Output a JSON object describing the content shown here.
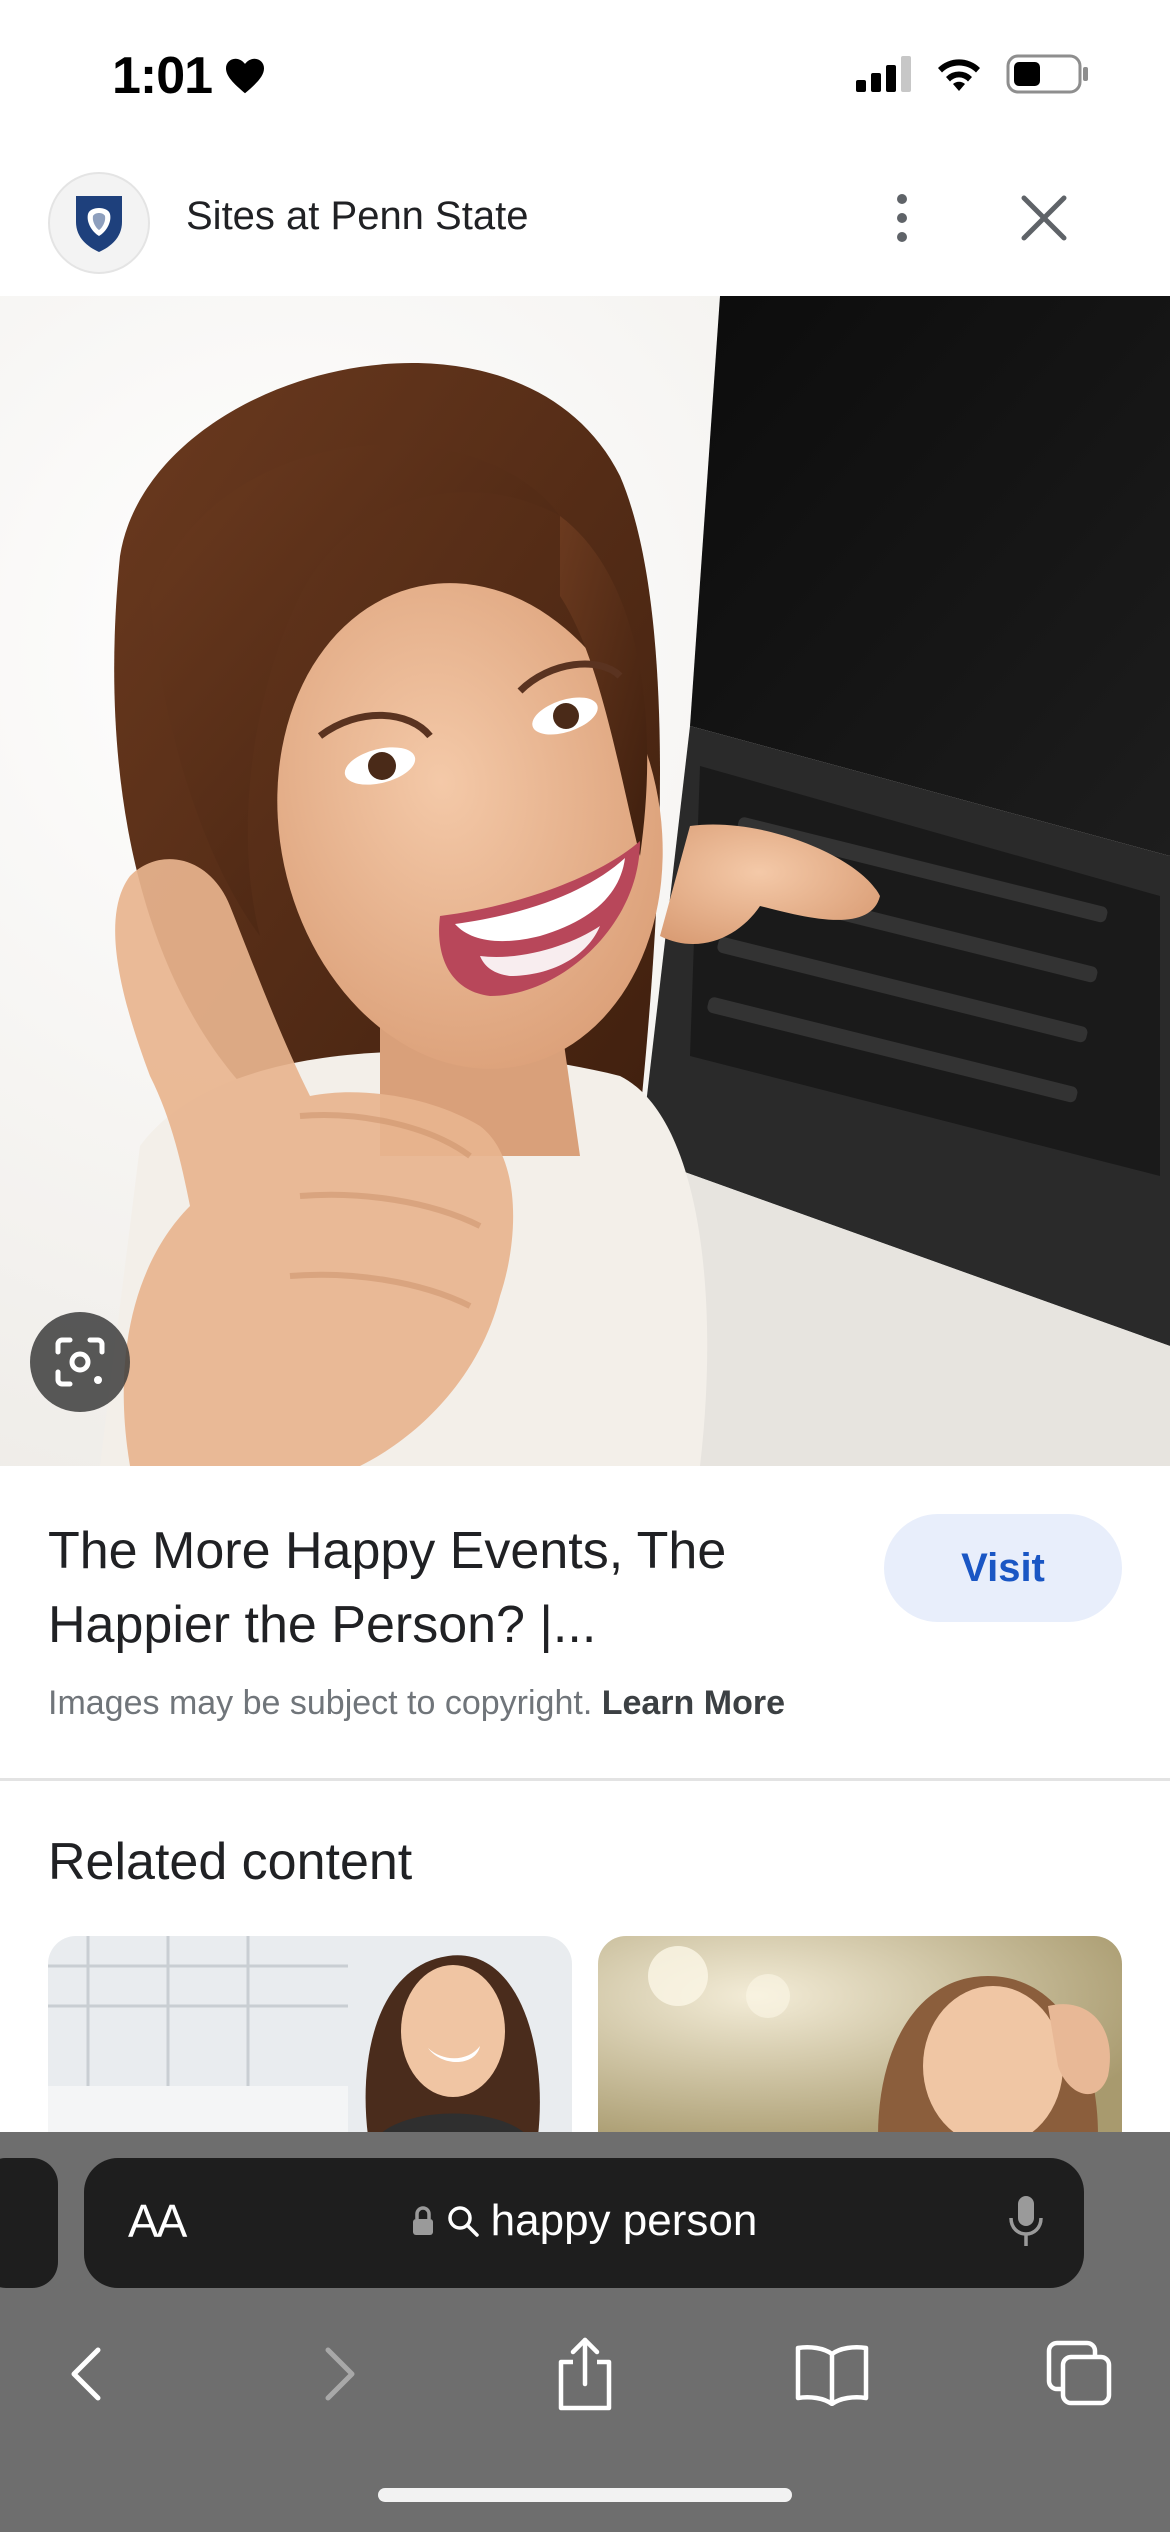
{
  "status_bar": {
    "time": "1:01"
  },
  "header": {
    "site_name": "Sites at Penn State"
  },
  "result": {
    "title": "The More Happy Events, The Happier the Person? |...",
    "visit_label": "Visit",
    "copyright_text": "Images may be subject to copyright.",
    "learn_more_label": "Learn More"
  },
  "related": {
    "heading": "Related content"
  },
  "browser": {
    "text_size_label": "AA",
    "search_query": "happy person"
  },
  "icons": {
    "status": [
      "heart-icon",
      "cellular-signal-icon",
      "wifi-icon",
      "battery-icon"
    ],
    "header": [
      "penn-state-shield-icon",
      "more-vertical-icon",
      "close-icon"
    ],
    "hero": [
      "visual-search-icon"
    ],
    "address": [
      "lock-icon",
      "search-icon",
      "microphone-icon"
    ],
    "toolbar": [
      "back-icon",
      "forward-icon",
      "share-icon",
      "bookmarks-icon",
      "tabs-icon"
    ]
  },
  "colors": {
    "visit_button_bg": "#e8eefb",
    "visit_button_text": "#1a56c4",
    "browser_bar": "#6e6e6e",
    "address_pill": "#1e1e1e"
  }
}
